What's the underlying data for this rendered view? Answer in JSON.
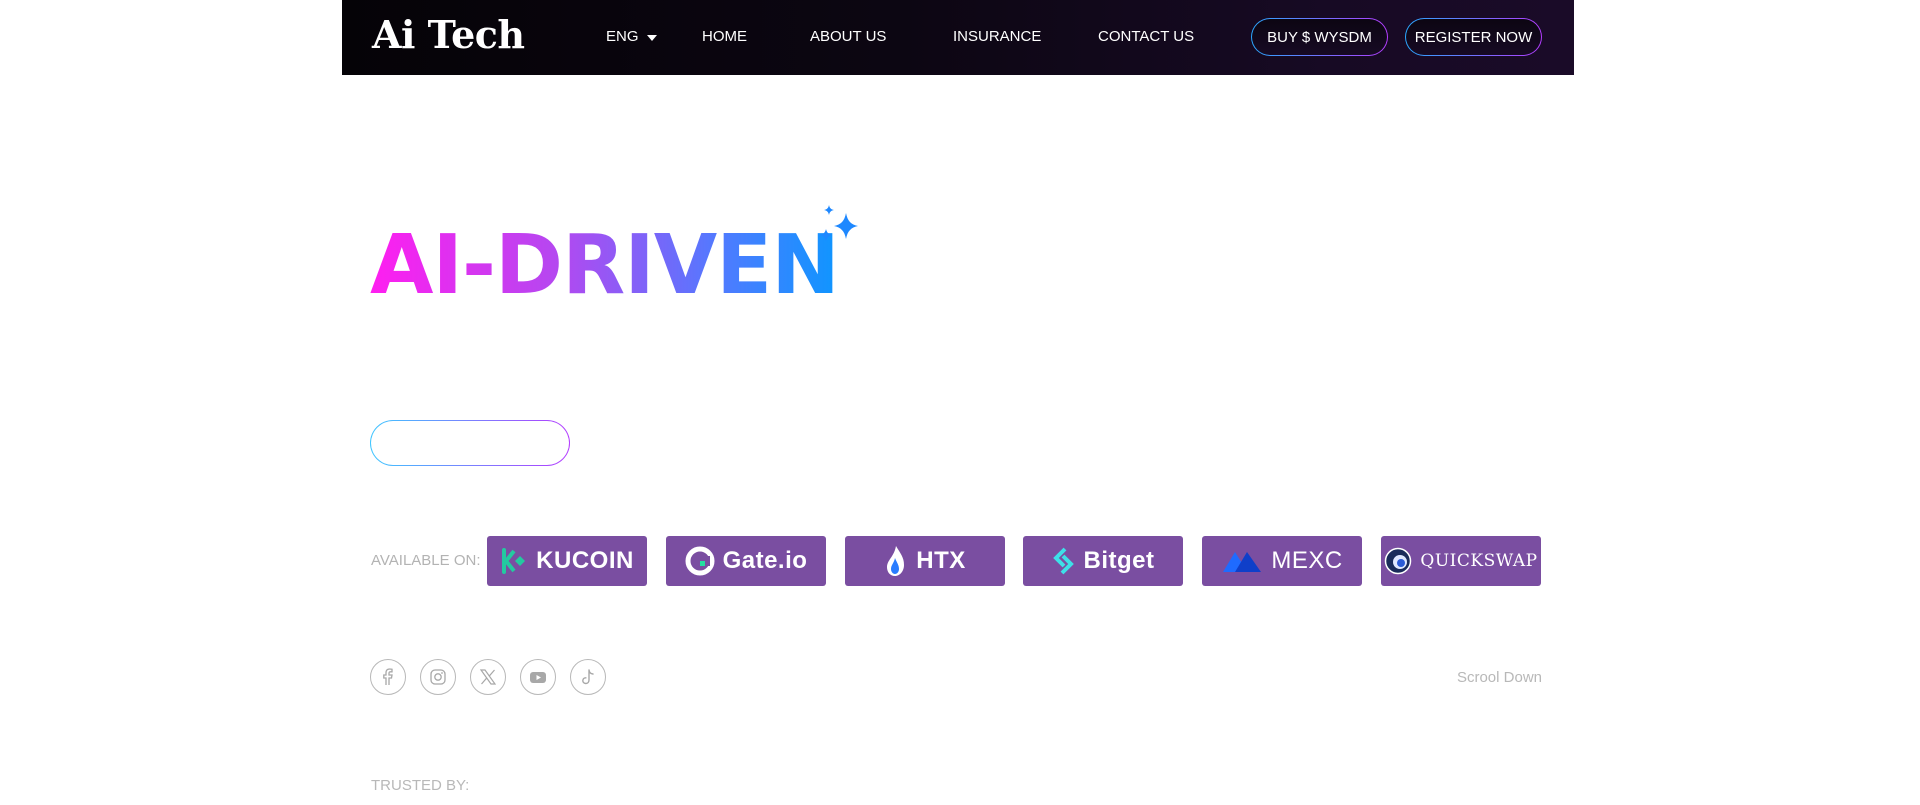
{
  "header": {
    "logo": "Ai Tech",
    "language": "ENG",
    "nav": [
      "HOME",
      "ABOUT US",
      "INSURANCE",
      "CONTACT US"
    ],
    "buy_label": "BUY $ WYSDM",
    "register_label": "REGISTER NOW"
  },
  "hero": {
    "title": "AI-DRIVEN",
    "gradient_colors": [
      "#ff1ef0",
      "#b448f0",
      "#4f7bff",
      "#0e96ff"
    ],
    "sparkle_color": "#1e88ff",
    "cta_label": ""
  },
  "available": {
    "label": "AVAILABLE ON:",
    "exchanges": [
      "KUCOIN",
      "Gate.io",
      "HTX",
      "Bitget",
      "MEXC",
      "QUICKSWAP"
    ],
    "badge_color": "#7a4ea1"
  },
  "socials": [
    "facebook-icon",
    "instagram-icon",
    "x-icon",
    "youtube-icon",
    "tiktok-icon"
  ],
  "scroll_down": "Scrool Down",
  "trusted_label": "TRUSTED BY:"
}
